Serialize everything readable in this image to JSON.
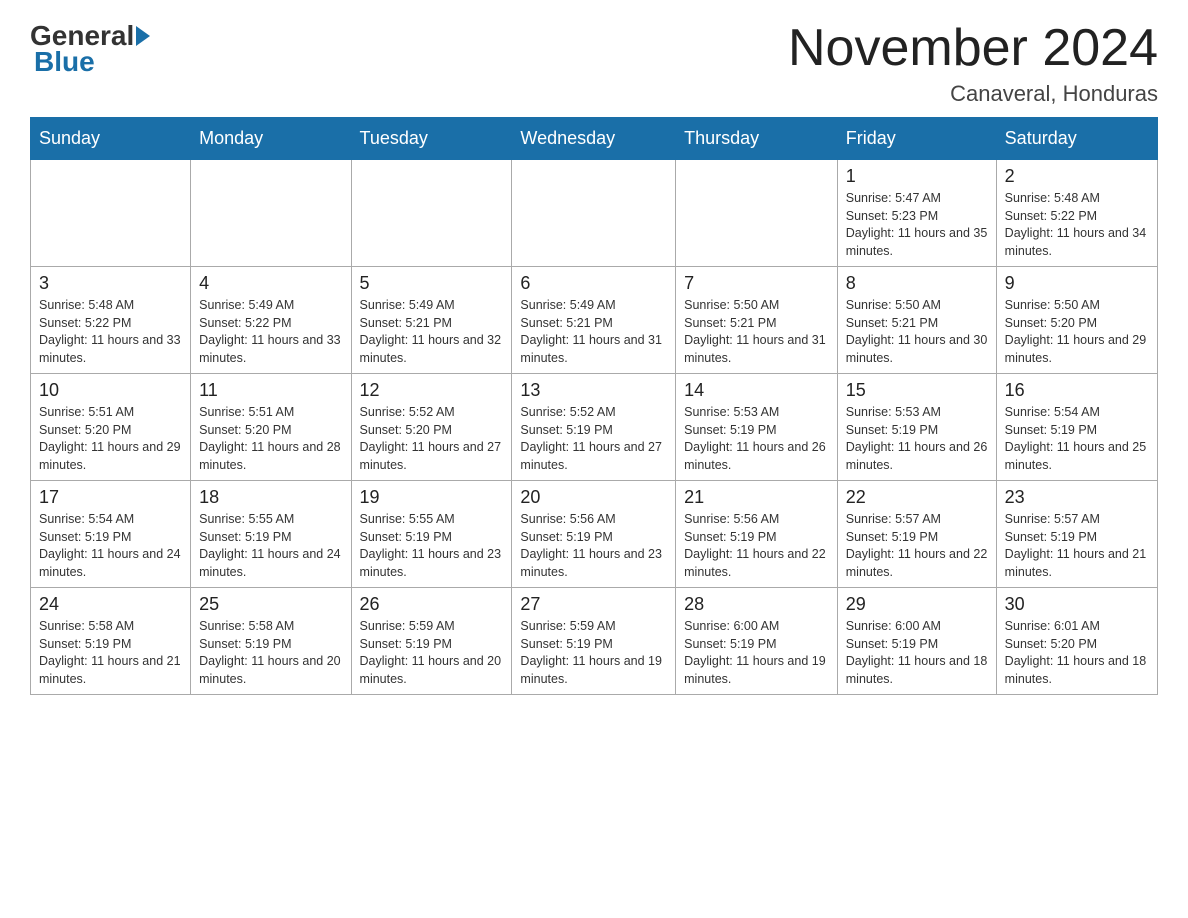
{
  "logo": {
    "general": "General",
    "blue": "Blue"
  },
  "title": "November 2024",
  "location": "Canaveral, Honduras",
  "days_of_week": [
    "Sunday",
    "Monday",
    "Tuesday",
    "Wednesday",
    "Thursday",
    "Friday",
    "Saturday"
  ],
  "weeks": [
    [
      {
        "day": "",
        "info": ""
      },
      {
        "day": "",
        "info": ""
      },
      {
        "day": "",
        "info": ""
      },
      {
        "day": "",
        "info": ""
      },
      {
        "day": "",
        "info": ""
      },
      {
        "day": "1",
        "info": "Sunrise: 5:47 AM\nSunset: 5:23 PM\nDaylight: 11 hours and 35 minutes."
      },
      {
        "day": "2",
        "info": "Sunrise: 5:48 AM\nSunset: 5:22 PM\nDaylight: 11 hours and 34 minutes."
      }
    ],
    [
      {
        "day": "3",
        "info": "Sunrise: 5:48 AM\nSunset: 5:22 PM\nDaylight: 11 hours and 33 minutes."
      },
      {
        "day": "4",
        "info": "Sunrise: 5:49 AM\nSunset: 5:22 PM\nDaylight: 11 hours and 33 minutes."
      },
      {
        "day": "5",
        "info": "Sunrise: 5:49 AM\nSunset: 5:21 PM\nDaylight: 11 hours and 32 minutes."
      },
      {
        "day": "6",
        "info": "Sunrise: 5:49 AM\nSunset: 5:21 PM\nDaylight: 11 hours and 31 minutes."
      },
      {
        "day": "7",
        "info": "Sunrise: 5:50 AM\nSunset: 5:21 PM\nDaylight: 11 hours and 31 minutes."
      },
      {
        "day": "8",
        "info": "Sunrise: 5:50 AM\nSunset: 5:21 PM\nDaylight: 11 hours and 30 minutes."
      },
      {
        "day": "9",
        "info": "Sunrise: 5:50 AM\nSunset: 5:20 PM\nDaylight: 11 hours and 29 minutes."
      }
    ],
    [
      {
        "day": "10",
        "info": "Sunrise: 5:51 AM\nSunset: 5:20 PM\nDaylight: 11 hours and 29 minutes."
      },
      {
        "day": "11",
        "info": "Sunrise: 5:51 AM\nSunset: 5:20 PM\nDaylight: 11 hours and 28 minutes."
      },
      {
        "day": "12",
        "info": "Sunrise: 5:52 AM\nSunset: 5:20 PM\nDaylight: 11 hours and 27 minutes."
      },
      {
        "day": "13",
        "info": "Sunrise: 5:52 AM\nSunset: 5:19 PM\nDaylight: 11 hours and 27 minutes."
      },
      {
        "day": "14",
        "info": "Sunrise: 5:53 AM\nSunset: 5:19 PM\nDaylight: 11 hours and 26 minutes."
      },
      {
        "day": "15",
        "info": "Sunrise: 5:53 AM\nSunset: 5:19 PM\nDaylight: 11 hours and 26 minutes."
      },
      {
        "day": "16",
        "info": "Sunrise: 5:54 AM\nSunset: 5:19 PM\nDaylight: 11 hours and 25 minutes."
      }
    ],
    [
      {
        "day": "17",
        "info": "Sunrise: 5:54 AM\nSunset: 5:19 PM\nDaylight: 11 hours and 24 minutes."
      },
      {
        "day": "18",
        "info": "Sunrise: 5:55 AM\nSunset: 5:19 PM\nDaylight: 11 hours and 24 minutes."
      },
      {
        "day": "19",
        "info": "Sunrise: 5:55 AM\nSunset: 5:19 PM\nDaylight: 11 hours and 23 minutes."
      },
      {
        "day": "20",
        "info": "Sunrise: 5:56 AM\nSunset: 5:19 PM\nDaylight: 11 hours and 23 minutes."
      },
      {
        "day": "21",
        "info": "Sunrise: 5:56 AM\nSunset: 5:19 PM\nDaylight: 11 hours and 22 minutes."
      },
      {
        "day": "22",
        "info": "Sunrise: 5:57 AM\nSunset: 5:19 PM\nDaylight: 11 hours and 22 minutes."
      },
      {
        "day": "23",
        "info": "Sunrise: 5:57 AM\nSunset: 5:19 PM\nDaylight: 11 hours and 21 minutes."
      }
    ],
    [
      {
        "day": "24",
        "info": "Sunrise: 5:58 AM\nSunset: 5:19 PM\nDaylight: 11 hours and 21 minutes."
      },
      {
        "day": "25",
        "info": "Sunrise: 5:58 AM\nSunset: 5:19 PM\nDaylight: 11 hours and 20 minutes."
      },
      {
        "day": "26",
        "info": "Sunrise: 5:59 AM\nSunset: 5:19 PM\nDaylight: 11 hours and 20 minutes."
      },
      {
        "day": "27",
        "info": "Sunrise: 5:59 AM\nSunset: 5:19 PM\nDaylight: 11 hours and 19 minutes."
      },
      {
        "day": "28",
        "info": "Sunrise: 6:00 AM\nSunset: 5:19 PM\nDaylight: 11 hours and 19 minutes."
      },
      {
        "day": "29",
        "info": "Sunrise: 6:00 AM\nSunset: 5:19 PM\nDaylight: 11 hours and 18 minutes."
      },
      {
        "day": "30",
        "info": "Sunrise: 6:01 AM\nSunset: 5:20 PM\nDaylight: 11 hours and 18 minutes."
      }
    ]
  ]
}
